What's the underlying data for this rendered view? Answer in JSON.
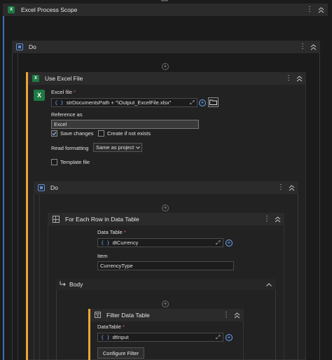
{
  "scope": {
    "title": "Excel Process Scope"
  },
  "do_outer": {
    "title": "Do"
  },
  "use_excel": {
    "title": "Use Excel File",
    "excel_file_label": "Excel file",
    "required_mark": "*",
    "excel_file_value": "strDocumentsPath + \"\\Output_ExcelFile.xlsx\"",
    "reference_label": "Reference as",
    "reference_value": "Excel",
    "save_changes_label": "Save changes",
    "create_label": "Create if not exists",
    "read_formatting_label": "Read formatting",
    "read_formatting_value": "Same as project",
    "template_label": "Template file",
    "save_changes_checked": true,
    "create_checked": false,
    "template_checked": false
  },
  "do_inner": {
    "title": "Do"
  },
  "for_each": {
    "title": "For Each Row in Data Table",
    "datatable_label": "Data Table",
    "required_mark": "*",
    "datatable_value": "dtCurrency",
    "item_label": "Item",
    "item_value": "CurrencyType"
  },
  "body": {
    "title": "Body"
  },
  "filter": {
    "title": "Filter Data Table",
    "datatable_label": "DataTable",
    "required_mark": "*",
    "datatable_value": "dtInput",
    "configure_label": "Configure Filter"
  },
  "braces": "{ }",
  "colors": {
    "accent": "#f0a531",
    "expr_blue": "#6aa7ff",
    "excel_green": "#1d7a43"
  }
}
